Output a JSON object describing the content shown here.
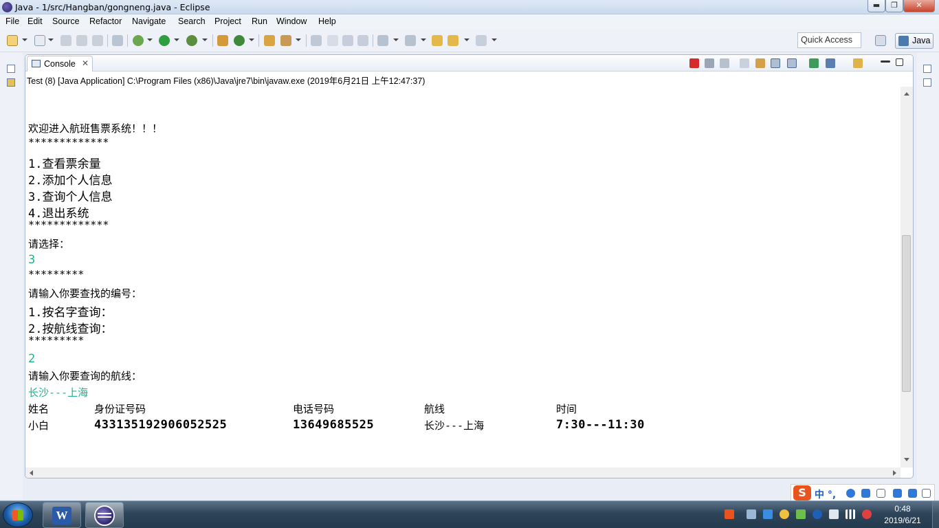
{
  "window": {
    "title": "Java - 1/src/Hangban/gongneng.java - Eclipse",
    "min_symbol": "▬",
    "max_symbol": "❐",
    "close_symbol": "✕"
  },
  "menu": [
    "File",
    "Edit",
    "Source",
    "Refactor",
    "Navigate",
    "Search",
    "Project",
    "Run",
    "Window",
    "Help"
  ],
  "toolbar": {
    "quick_access": "Quick Access",
    "perspective": "Java"
  },
  "console": {
    "tab_label": "Console",
    "tab_close": "✕",
    "info_line": "Test (8) [Java Application] C:\\Program Files (x86)\\Java\\jre7\\bin\\javaw.exe (2019年6月21日 上午12:47:37)",
    "lines": [
      "欢迎进入航班售票系统！！！",
      "*************",
      "1.查看票余量",
      "2.添加个人信息",
      "3.查询个人信息",
      "4.退出系统",
      "*************",
      "请选择：",
      "3",
      "*********",
      "请输入你要查找的编号：",
      "1.按名字查询：",
      "2.按航线查询：",
      "*********",
      "2",
      "请输入你要查询的航线：",
      "长沙---上海"
    ],
    "table_header": [
      "姓名",
      "身份证号码",
      "电话号码",
      "航线",
      "时间"
    ],
    "table_row": [
      "小白",
      "433135192906052525",
      "13649685525",
      "长沙---上海",
      "7:30---11:30"
    ],
    "input_color": "#1bb38a"
  },
  "ime": {
    "logo": "S",
    "mode": "中 °,"
  },
  "taskbar": {
    "word_label": "W",
    "clock_time": "0:48",
    "clock_date": "2019/6/21"
  }
}
